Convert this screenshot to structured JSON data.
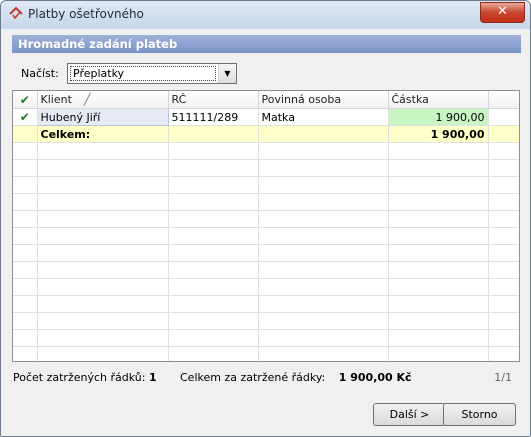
{
  "window": {
    "title": "Platby ošetřovného",
    "close_label": "✕"
  },
  "header": {
    "band_title": "Hromadné zadání plateb"
  },
  "load": {
    "label": "Načíst:",
    "selected": "Přeplatky"
  },
  "grid": {
    "columns": [
      "✔",
      "Klient",
      "RČ",
      "Povinná osoba",
      "Částka"
    ],
    "rows": [
      {
        "check": "✔",
        "client": "Hubený Jiří",
        "rc": "511111/289",
        "person": "Matka",
        "amount": "1 900,00"
      }
    ],
    "total": {
      "label": "Celkem:",
      "amount": "1 900,00"
    }
  },
  "status": {
    "checked_rows_label": "Počet zatržených řádků:",
    "checked_rows_value": "1",
    "total_label": "Celkem za zatržené řádky:",
    "total_value": "1 900,00 Kč",
    "paging": "1/1"
  },
  "buttons": {
    "next": "Další >",
    "cancel": "Storno"
  }
}
